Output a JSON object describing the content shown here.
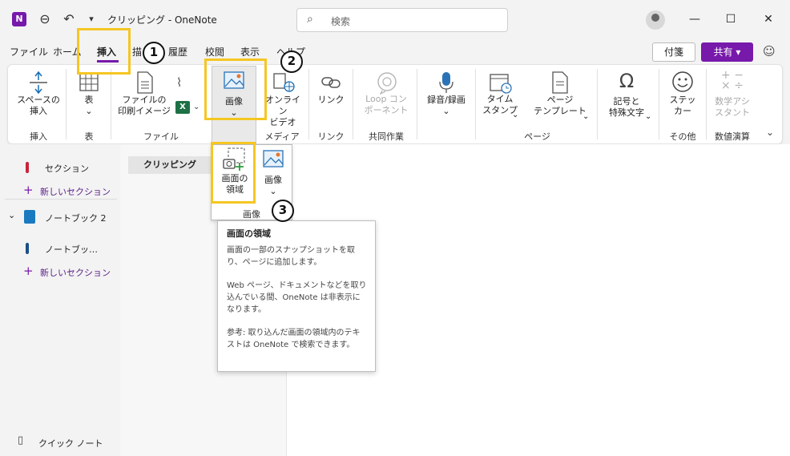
{
  "titlebar": {
    "app_letter": "N",
    "title": "クリッピング - OneNote",
    "search_placeholder": "検索",
    "minimize": "—",
    "maximize": "☐",
    "close": "✕",
    "back": "⊖",
    "undo": "↶",
    "dropdown": "▾"
  },
  "tabs": [
    "ファイル",
    "ホーム",
    "挿入",
    "描",
    "履歴",
    "校閲",
    "表示",
    "ヘルプ"
  ],
  "toolbar_right": {
    "fusen": "付箋",
    "share": "共有"
  },
  "ribbon": {
    "space": "スペースの\n挿入",
    "table": "表",
    "file_print": "ファイルの\n印刷イメージ",
    "image": "画像",
    "online_video": "オンライン\nビデオ",
    "link": "リンク",
    "loop": "Loop コン\nポーネント",
    "record": "録音/録画",
    "timestamp": "タイム\nスタンプ",
    "page_template": "ページ\nテンプレート",
    "symbol": "記号と\n特殊文字",
    "sticker": "ステッ\nカー",
    "math": "数学アシ\nスタント",
    "groups": {
      "insert": "挿入",
      "table": "表",
      "file": "ファイル",
      "media": "メディア",
      "link": "リンク",
      "collab": "共同作業",
      "page": "ページ",
      "other": "その他",
      "math": "数値演算"
    }
  },
  "sidebar": {
    "section1": "セクション",
    "new_section1": "新しいセクション",
    "notebook2": "ノートブック 2",
    "section2": "ノートブッ…",
    "new_section2": "新しいセクション",
    "quick_notes": "クイック ノート"
  },
  "pages": {
    "item": "クリッピング"
  },
  "dropdown": {
    "screen_clip": "画面の\n領域",
    "image": "画像",
    "group_label": "画像"
  },
  "tooltip": {
    "title": "画面の領域",
    "p1": "画面の一部のスナップショットを取り、ページに追加します。",
    "p2": "Web ページ、ドキュメントなどを取り込んでいる間、OneNote は非表示になります。",
    "p3": "参考: 取り込んだ画面の領域内のテキストは OneNote で検索できます。"
  },
  "markers": {
    "m1": "1",
    "m2": "2",
    "m3": "3"
  },
  "colors": {
    "accent": "#7719aa",
    "highlight": "#f5c623"
  }
}
